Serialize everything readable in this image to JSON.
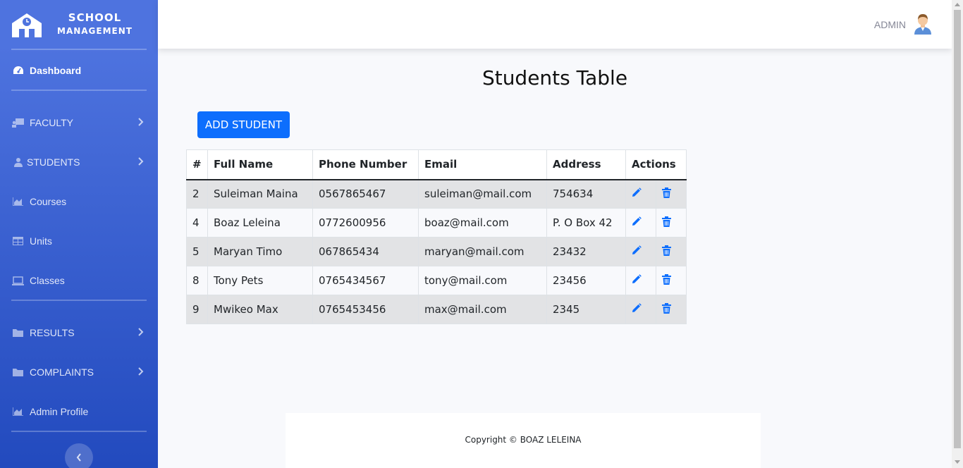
{
  "brand": {
    "line1": "SCHOOL",
    "line2": "MANAGEMENT"
  },
  "sidebar": {
    "items": [
      {
        "label": "Dashboard",
        "icon": "tachometer-icon"
      },
      {
        "label": "FACULTY",
        "icon": "chalkboard-teacher-icon"
      },
      {
        "label": "STUDENTS",
        "icon": "user-graduate-icon"
      },
      {
        "label": "Courses",
        "icon": "chart-area-icon"
      },
      {
        "label": "Units",
        "icon": "table-icon"
      },
      {
        "label": "Classes",
        "icon": "laptop-icon"
      },
      {
        "label": "RESULTS",
        "icon": "folder-icon"
      },
      {
        "label": "COMPLAINTS",
        "icon": "folder-icon"
      },
      {
        "label": "Admin Profile",
        "icon": "chart-area-icon"
      }
    ]
  },
  "topbar": {
    "user": "ADMIN"
  },
  "main": {
    "title": "Students Table",
    "add_button": "ADD STUDENT",
    "table": {
      "headers": [
        "#",
        "Full Name",
        "Phone Number",
        "Email",
        "Address",
        "Actions"
      ],
      "rows": [
        [
          "2",
          "Suleiman Maina",
          "0567865467",
          "suleiman@mail.com",
          "754634"
        ],
        [
          "4",
          "Boaz Leleina",
          "0772600956",
          "boaz@mail.com",
          "P. O Box 42"
        ],
        [
          "5",
          "Maryan Timo",
          "067865434",
          "maryan@mail.com",
          "23432"
        ],
        [
          "8",
          "Tony Pets",
          "0765434567",
          "tony@mail.com",
          "23456"
        ],
        [
          "9",
          "Mwikeo Max",
          "0765453456",
          "max@mail.com",
          "2345"
        ]
      ]
    }
  },
  "footer": {
    "text": "Copyright © BOAZ LELEINA"
  },
  "colors": {
    "sidebar_start": "#4e73df",
    "sidebar_end": "#224abe",
    "primary": "#0d6efd"
  }
}
